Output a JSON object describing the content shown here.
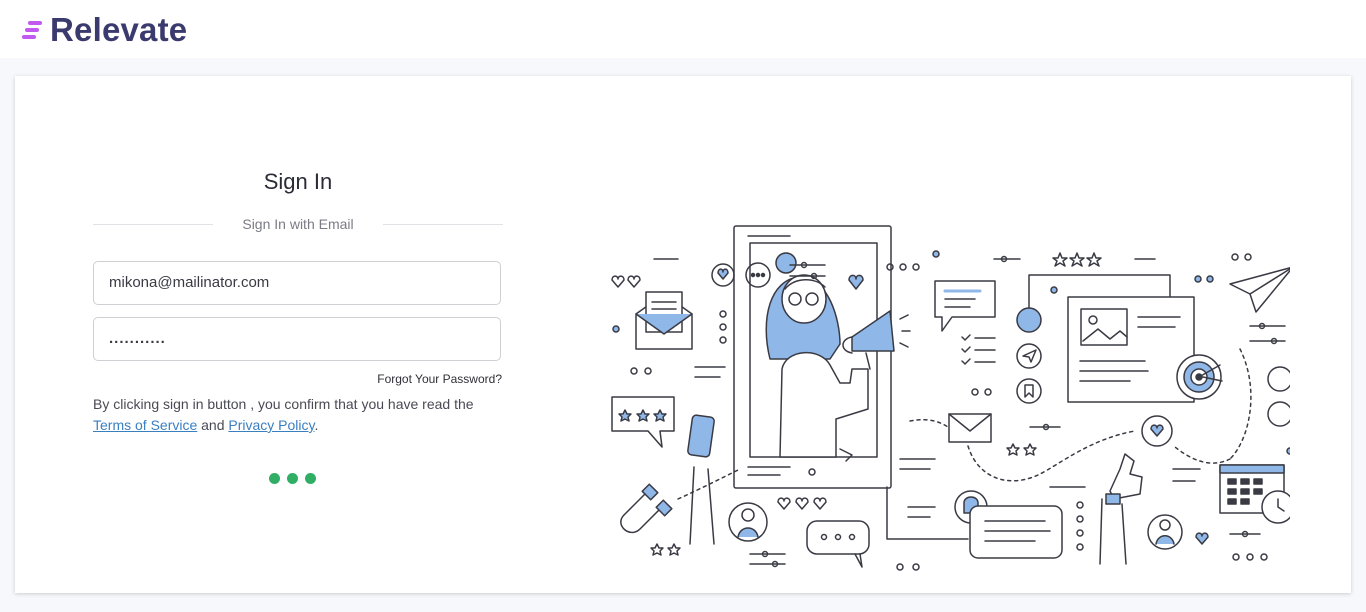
{
  "brand": {
    "name": "Relevate"
  },
  "signin": {
    "title": "Sign In",
    "subtitle": "Sign In with Email",
    "email_value": "mikona@mailinator.com",
    "password_masked": "...........",
    "forgot_label": "Forgot Your Password?",
    "consent_prefix": "By clicking sign in button , you confirm that you have read the ",
    "terms_label": "Terms of Service",
    "and_text": " and ",
    "privacy_label": "Privacy Policy",
    "period": "."
  },
  "colors": {
    "brand_text": "#3b3a6e",
    "brand_mark": "#c15bf0",
    "loader": "#2fae64",
    "link": "#3a7fc0",
    "illustration_accent": "#8fb8e8"
  },
  "illustration": {
    "icons": [
      "envelope-icon",
      "megaphone-icon",
      "chat-bubble-icon",
      "paper-plane-icon",
      "target-icon",
      "calendar-icon",
      "magnet-icon",
      "smartphone-icon",
      "thumbs-up-icon",
      "bell-icon",
      "heart-icon",
      "star-icon",
      "user-icon"
    ]
  }
}
